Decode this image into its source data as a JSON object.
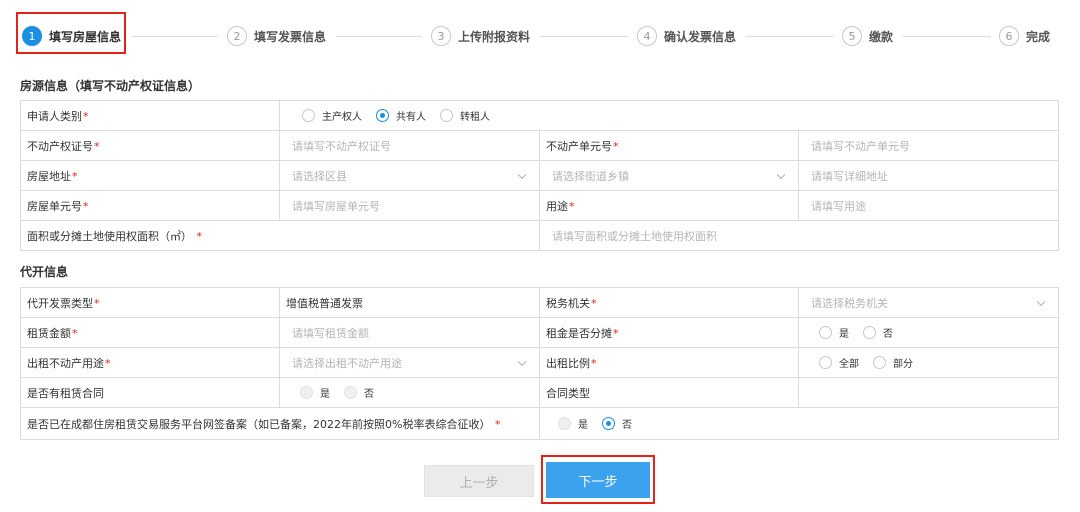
{
  "steps": [
    {
      "num": "1",
      "label": "填写房屋信息"
    },
    {
      "num": "2",
      "label": "填写发票信息"
    },
    {
      "num": "3",
      "label": "上传附报资料"
    },
    {
      "num": "4",
      "label": "确认发票信息"
    },
    {
      "num": "5",
      "label": "缴款"
    },
    {
      "num": "6",
      "label": "完成"
    }
  ],
  "accent_color": "#1c8fe0",
  "highlight_color": "#e2231a",
  "house_section": {
    "title": "房源信息（填写不动产权证信息）",
    "applicant_type": {
      "label": "申请人类别",
      "options": [
        "主产权人",
        "共有人",
        "转租人"
      ],
      "selected": "共有人"
    },
    "cert_no": {
      "label": "不动产权证号",
      "placeholder": "请填写不动产权证号"
    },
    "unit_no": {
      "label": "不动产单元号",
      "placeholder": "请填写不动产单元号"
    },
    "address": {
      "label": "房屋地址",
      "district_placeholder": "请选择区县",
      "street_placeholder": "请选择街道乡镇",
      "detail_placeholder": "请填写详细地址"
    },
    "room_no": {
      "label": "房屋单元号",
      "placeholder": "请填写房屋单元号"
    },
    "usage": {
      "label": "用途",
      "placeholder": "请填写用途"
    },
    "area": {
      "label": "面积或分摊土地使用权面积（㎡）",
      "placeholder": "请填写面积或分摊土地使用权面积"
    }
  },
  "invoice_section": {
    "title": "代开信息",
    "invoice_type": {
      "label": "代开发票类型",
      "value": "增值税普通发票"
    },
    "tax_office": {
      "label": "税务机关",
      "placeholder": "请选择税务机关"
    },
    "rent_amount": {
      "label": "租赁金额",
      "placeholder": "请填写租赁金额"
    },
    "rent_shared": {
      "label": "租金是否分摊",
      "options": [
        "是",
        "否"
      ],
      "selected": ""
    },
    "rent_purpose": {
      "label": "出租不动产用途",
      "placeholder": "请选择出租不动产用途"
    },
    "rent_ratio": {
      "label": "出租比例",
      "options": [
        "全部",
        "部分"
      ],
      "selected": ""
    },
    "has_contract": {
      "label": "是否有租赁合同",
      "options": [
        "是",
        "否"
      ],
      "selected": ""
    },
    "contract_type": {
      "label": "合同类型"
    },
    "filed": {
      "label": "是否已在成都住房租赁交易服务平台网签备案（如已备案，2022年前按照0%税率表综合征收）",
      "options": [
        "是",
        "否"
      ],
      "selected": "否"
    }
  },
  "buttons": {
    "prev": "上一步",
    "next": "下一步"
  }
}
